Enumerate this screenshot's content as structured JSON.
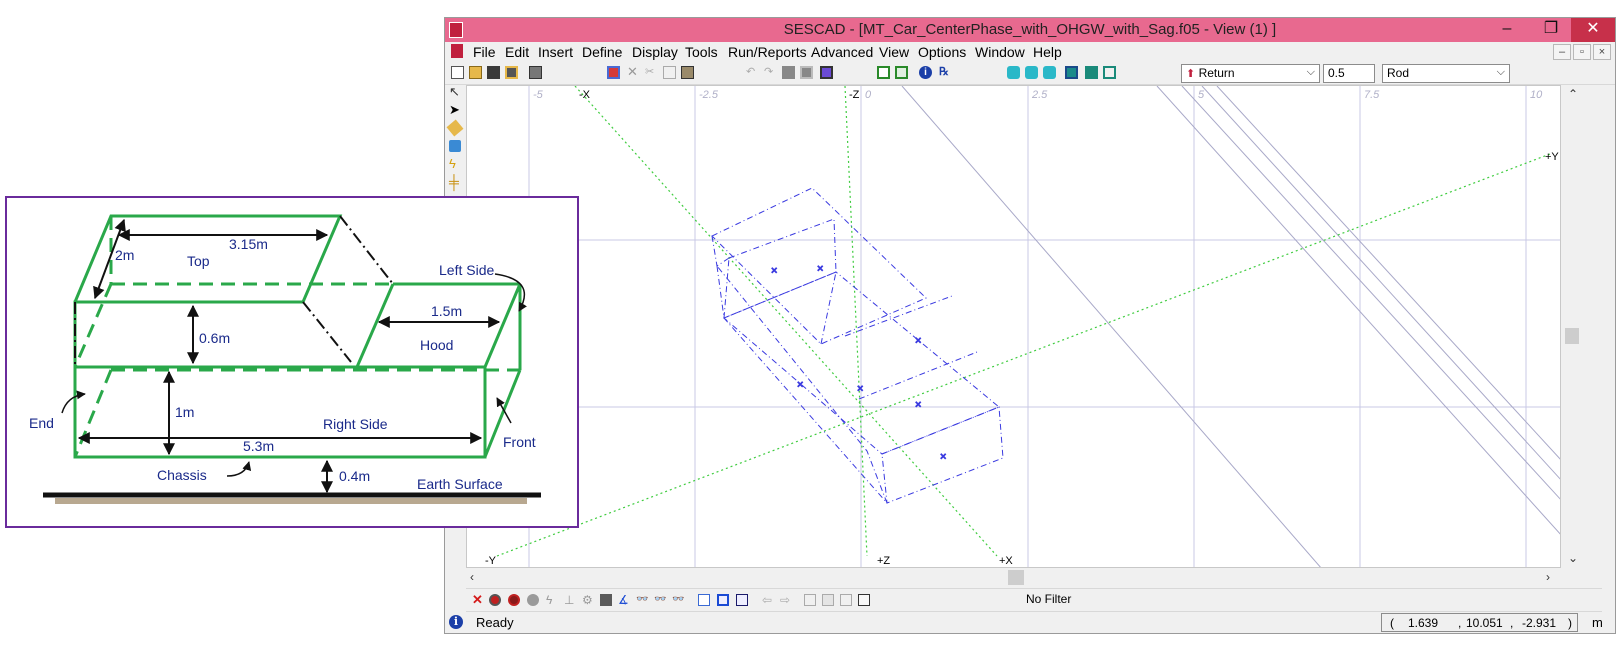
{
  "window": {
    "title": "SESCAD - [MT_Car_CenterPhase_with_OHGW_with_Sag.f05 - View (1) ]",
    "minimize_glyph": "–",
    "restore_glyph": "❐",
    "close_glyph": "✕"
  },
  "menu": {
    "items": [
      "File",
      "Edit",
      "Insert",
      "Define",
      "Display",
      "Tools",
      "Run/Reports",
      "Advanced",
      "View",
      "Options",
      "Window",
      "Help"
    ]
  },
  "toolbar": {
    "mode_select": "Return",
    "value_field": "0.5",
    "type_select": "Rod"
  },
  "viewport": {
    "x_ticks": [
      "-5",
      "-2.5",
      "0",
      "2.5",
      "5",
      "7.5",
      "10"
    ],
    "axis_labels": {
      "neg_x": "-X",
      "neg_z": "-Z",
      "pos_y": "+Y",
      "neg_y": "-Y",
      "pos_z": "+Z",
      "pos_x": "+X"
    },
    "axis_color": "#3fcc3f",
    "model_color": "#3a3ae0",
    "grid_color": "#c8c8e6"
  },
  "bottom_bar": {
    "filter_label": "No Filter"
  },
  "status": {
    "text": "Ready",
    "coord_open": "(",
    "coord_x": "1.639",
    "coord_sep1": ",",
    "coord_y": "10.051",
    "coord_sep2": ",",
    "coord_z": "-2.931",
    "coord_close": ")",
    "unit": "m"
  },
  "diagram": {
    "labels": {
      "depth": "2m",
      "length_top": "3.15m",
      "top": "Top",
      "left_side": "Left Side",
      "hood_length": "1.5m",
      "cabin_height": "0.6m",
      "hood": "Hood",
      "end": "End",
      "body_height": "1m",
      "right_side": "Right Side",
      "front": "Front",
      "length_total": "5.3m",
      "chassis": "Chassis",
      "clearance": "0.4m",
      "earth_surface": "Earth Surface"
    },
    "line_color": "#2aa84a",
    "frame_color": "#6a2b9c"
  }
}
